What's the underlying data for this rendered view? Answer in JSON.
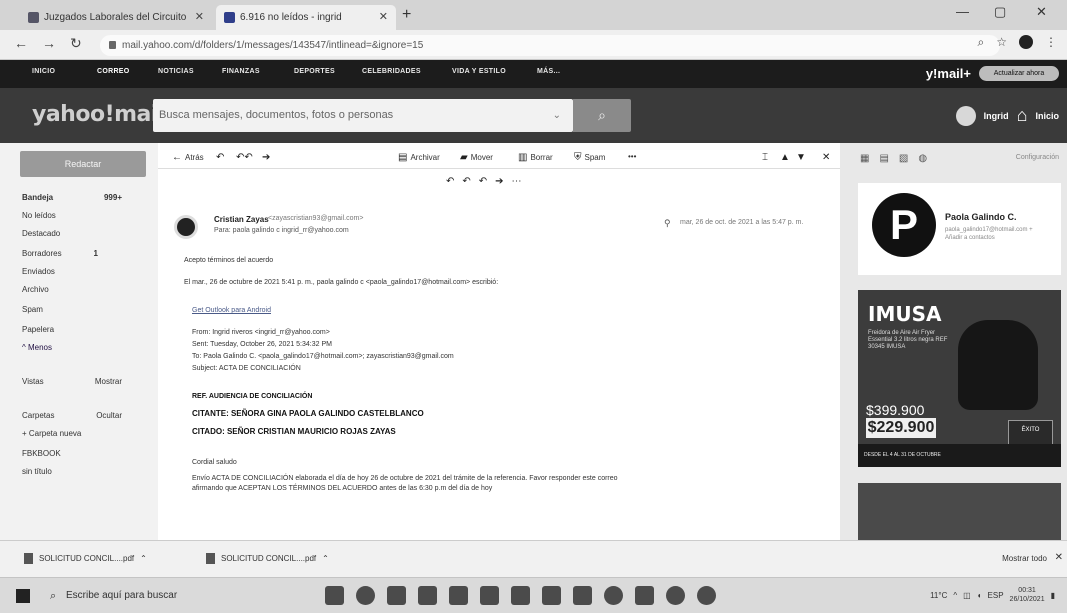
{
  "browser": {
    "tab1_label": "Juzgados Laborales del Circuito",
    "tab2_label": "6.916 no leídos - ingrid",
    "url": "mail.yahoo.com/d/folders/1/messages/143547/intlinead=&ignore=15",
    "newtab": "+"
  },
  "ynav": {
    "items": [
      "INICIO",
      "CORREO",
      "NOTICIAS",
      "FINANZAS",
      "DEPORTES",
      "CELEBRIDADES",
      "VIDA Y ESTILO",
      "MÁS..."
    ],
    "mail_logo": "y!mail+",
    "upgrade": "Actualizar ahora"
  },
  "header": {
    "logo": "yahoo!mail",
    "search_placeholder": "Busca mensajes, documentos, fotos o personas",
    "user_name": "Ingrid",
    "home_label": "Inicio"
  },
  "sidebar": {
    "compose": "Redactar",
    "folders": [
      {
        "label": "Bandeja",
        "count": "999+"
      },
      {
        "label": "No leídos",
        "count": ""
      },
      {
        "label": "Destacado",
        "count": ""
      },
      {
        "label": "Borradores",
        "count": "1"
      },
      {
        "label": "Enviados",
        "count": ""
      },
      {
        "label": "Archivo",
        "count": ""
      },
      {
        "label": "Spam",
        "count": ""
      },
      {
        "label": "Papelera",
        "count": ""
      },
      {
        "label": "^ Menos",
        "count": ""
      }
    ],
    "views_label": "Vistas",
    "views_action": "Mostrar",
    "folders_label": "Carpetas",
    "folders_action": "Ocultar",
    "new_folder": "+ Carpeta nueva",
    "extra_folders": [
      "FBKBOOK",
      "sin título"
    ]
  },
  "toolbar": {
    "back": "Atrás",
    "archive": "Archivar",
    "move": "Mover",
    "delete": "Borrar",
    "spam": "Spam",
    "more": "•••"
  },
  "message": {
    "sender_name": "Cristian Zayas",
    "sender_email": "<zayascristian93@gmail.com>",
    "to_line": "Para: paola galindo c   ingrid_rr@yahoo.com",
    "date": "mar, 26 de oct. de 2021 a las 5:47 p. m.",
    "line1": "Acepto términos del acuerdo",
    "line2": "El mar., 26 de octubre de 2021 5:41 p. m., paola galindo c <paola_galindo17@hotmail.com> escribió:",
    "line3": "Get Outlook para Android",
    "line4": "From: Ingrid riveros <ingrid_rr@yahoo.com>",
    "line5": "Sent: Tuesday, October 26, 2021 5:34:32 PM",
    "line6": "To: Paola Galindo C. <paola_galindo17@hotmail.com>; zayascristian93@gmail.com",
    "line7": "Subject: ACTA DE CONCILIACIÓN",
    "line8": "REF. AUDIENCIA DE CONCILIACIÓN",
    "line9": "CITANTE:    SEÑORA  GINA PAOLA GALINDO CASTELBLANCO",
    "line10": "CITADO:    SEÑOR  CRISTIAN MAURICIO ROJAS ZAYAS",
    "line11": "Cordial saludo",
    "line12": "Envío ACTA DE CONCILIACIÓN elaborada el día de hoy 26 de octubre de 2021 del trámite de la referencia. Favor responder este correo",
    "line13": "afirmando que ACEPTAN LOS TÉRMINOS DEL ACUERDO  antes de las 6:30 p.m del día de hoy"
  },
  "right_panel": {
    "settings": "Configuración",
    "contact_initial": "P",
    "contact_name": "Paola Galindo C.",
    "contact_sub": "paola_galindo17@hotmail.com  + Añadir a contactos",
    "ad_brand": "IMUSA",
    "ad_desc": "Freidora de Aire Air Fryer Essential 3.2 litros negra REF 30345 IMUSA",
    "ad_oldprice": "$399.900",
    "ad_newprice": "$229.900",
    "ad_strip": "DESDE EL 4 AL 31 DE OCTUBRE",
    "ad_badge": "ÉXITO"
  },
  "downloads": {
    "item1": "SOLICITUD CONCIL....pdf",
    "item2": "SOLICITUD CONCIL....pdf",
    "show_all": "Mostrar todo"
  },
  "taskbar": {
    "search_placeholder": "Escribe aquí para buscar",
    "temp": "11°C",
    "lang": "ESP",
    "time": "00:31",
    "date": "26/10/2021"
  }
}
